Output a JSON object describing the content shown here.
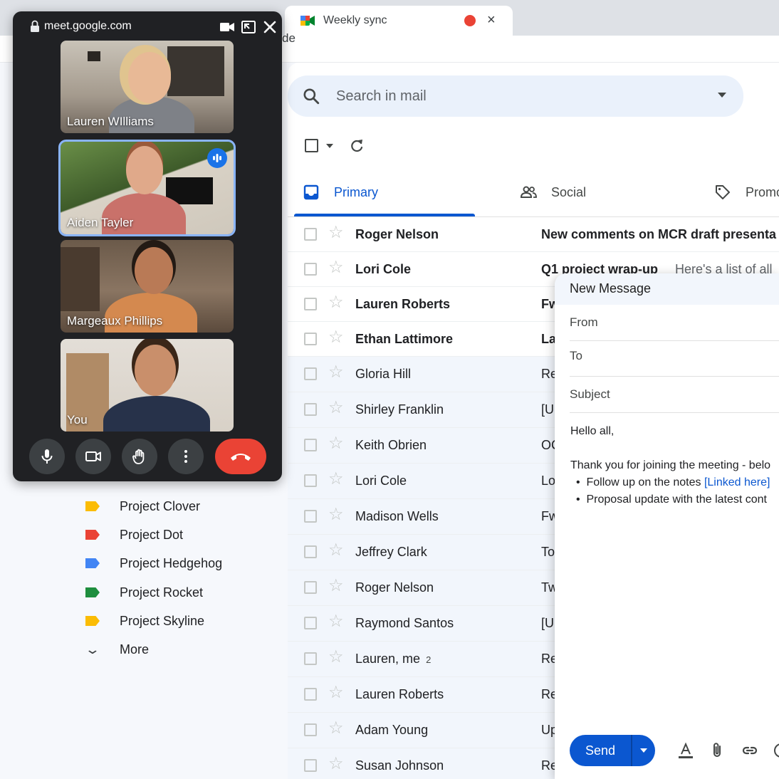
{
  "browser": {
    "tab_title": "Weekly sync",
    "tab_close": "×",
    "url_fragment": "de"
  },
  "meet": {
    "url": "meet.google.com",
    "participants": [
      {
        "name": "Lauren WIlliams",
        "speaking": false
      },
      {
        "name": "Aiden Tayler",
        "speaking": true
      },
      {
        "name": "Margeaux Phillips",
        "speaking": false
      },
      {
        "name": "You",
        "speaking": false
      }
    ],
    "controls": [
      "microphone-icon",
      "camera-icon",
      "raise-hand-icon",
      "more-options-icon",
      "end-call-icon"
    ],
    "end_call_color": "#ea4335"
  },
  "sidebar": {
    "labels": [
      {
        "text": "Project Clover",
        "color": "#fbbc04"
      },
      {
        "text": "Project Dot",
        "color": "#ea4335"
      },
      {
        "text": "Project Hedgehog",
        "color": "#4285f4"
      },
      {
        "text": "Project Rocket",
        "color": "#1e8e3e"
      },
      {
        "text": "Project Skyline",
        "color": "#fbbc04"
      }
    ],
    "more_label": "More"
  },
  "search": {
    "placeholder": "Search in mail"
  },
  "tabs": [
    {
      "label": "Primary",
      "active": true
    },
    {
      "label": "Social",
      "active": false
    },
    {
      "label": "Promo",
      "active": false
    }
  ],
  "emails": [
    {
      "sender": "Roger Nelson",
      "count": "",
      "subject": "New comments on MCR draft presenta",
      "snippet": "",
      "unread": true
    },
    {
      "sender": "Lori Cole",
      "count": "",
      "subject": "Q1 project wrap-up",
      "snippet": "Here's a list of all",
      "unread": true
    },
    {
      "sender": "Lauren Roberts",
      "count": "",
      "subject": "Fw",
      "snippet": "",
      "unread": true
    },
    {
      "sender": "Ethan Lattimore",
      "count": "",
      "subject": "La",
      "snippet": "",
      "unread": true
    },
    {
      "sender": "Gloria Hill",
      "count": "",
      "subject": "Re",
      "snippet": "",
      "unread": false
    },
    {
      "sender": "Shirley Franklin",
      "count": "",
      "subject": "[U",
      "snippet": "",
      "unread": false
    },
    {
      "sender": "Keith Obrien",
      "count": "",
      "subject": "OC",
      "snippet": "",
      "unread": false
    },
    {
      "sender": "Lori Cole",
      "count": "",
      "subject": "Lo",
      "snippet": "",
      "unread": false
    },
    {
      "sender": "Madison Wells",
      "count": "",
      "subject": "Fw",
      "snippet": "",
      "unread": false
    },
    {
      "sender": "Jeffrey Clark",
      "count": "",
      "subject": "To",
      "snippet": "",
      "unread": false
    },
    {
      "sender": "Roger Nelson",
      "count": "",
      "subject": "Tw",
      "snippet": "",
      "unread": false
    },
    {
      "sender": "Raymond Santos",
      "count": "",
      "subject": "[U",
      "snippet": "",
      "unread": false
    },
    {
      "sender": "Lauren, me",
      "count": "2",
      "subject": "Re",
      "snippet": "",
      "unread": false
    },
    {
      "sender": "Lauren Roberts",
      "count": "",
      "subject": "Re",
      "snippet": "",
      "unread": false
    },
    {
      "sender": "Adam Young",
      "count": "",
      "subject": "Up",
      "snippet": "",
      "unread": false
    },
    {
      "sender": "Susan Johnson",
      "count": "",
      "subject": "Re",
      "snippet": "",
      "unread": false
    }
  ],
  "compose": {
    "title": "New Message",
    "from_label": "From",
    "to_label": "To",
    "subject_label": "Subject",
    "greeting": "Hello all,",
    "intro": "Thank you for joining the meeting - belo",
    "bullet_1": "Follow up on the notes",
    "bullet_1_link": "[Linked here]",
    "bullet_2": "Proposal update with the latest cont",
    "send_label": "Send",
    "accent": "#0b57d0"
  }
}
